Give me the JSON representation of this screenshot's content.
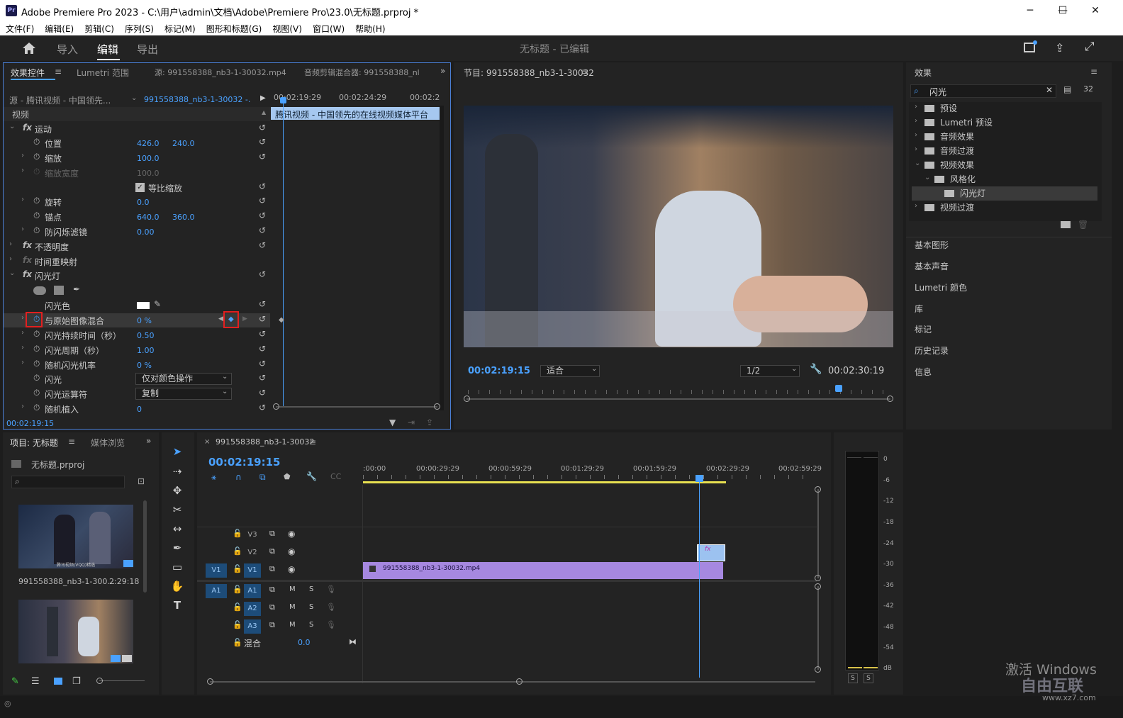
{
  "window": {
    "title": "Adobe Premiere Pro 2023 - C:\\用户\\admin\\文档\\Adobe\\Premiere Pro\\23.0\\无标题.prproj *",
    "app_icon": "Pr"
  },
  "menu": [
    "文件(F)",
    "编辑(E)",
    "剪辑(C)",
    "序列(S)",
    "标记(M)",
    "图形和标题(G)",
    "视图(V)",
    "窗口(W)",
    "帮助(H)"
  ],
  "header": {
    "tabs": [
      "导入",
      "编辑",
      "导出"
    ],
    "active_tab": "编辑",
    "doc_title": "无标题 - 已编辑"
  },
  "effect_controls": {
    "tabs": [
      "效果控件",
      "Lumetri 范围",
      "源: 991558388_nb3-1-30032.mp4",
      "音频剪辑混合器: 991558388_nl"
    ],
    "source": "源 - 腾讯视频 - 中国领先...",
    "clip": "991558388_nb3-1-30032 -...",
    "ruler": [
      "00:02:19:29",
      "00:02:24:29",
      "00:02:2"
    ],
    "clip_bar": "腾讯视频 - 中国领先的在线视频媒体平台",
    "section_video": "视频",
    "motion": "运动",
    "position": {
      "label": "位置",
      "x": "426.0",
      "y": "240.0"
    },
    "scale": {
      "label": "缩放",
      "v": "100.0"
    },
    "scale_width": {
      "label": "缩放宽度",
      "v": "100.0"
    },
    "uniform": "等比缩放",
    "rotation": {
      "label": "旋转",
      "v": "0.0"
    },
    "anchor": {
      "label": "锚点",
      "x": "640.0",
      "y": "360.0"
    },
    "antiflicker": {
      "label": "防闪烁滤镜",
      "v": "0.00"
    },
    "opacity": "不透明度",
    "time_remap": "时间重映射",
    "strobe": "闪光灯",
    "strobe_color": "闪光色",
    "blend": {
      "label": "与原始图像混合",
      "v": "0 %"
    },
    "duration": {
      "label": "闪光持续时间（秒）",
      "v": "0.50"
    },
    "period": {
      "label": "闪光周期（秒）",
      "v": "1.00"
    },
    "random": {
      "label": "随机闪光机率",
      "v": "0 %"
    },
    "flash": {
      "label": "闪光",
      "v": "仅对颜色操作"
    },
    "operator": {
      "label": "闪光运算符",
      "v": "复制"
    },
    "seed": {
      "label": "随机植入",
      "v": "0"
    },
    "timecode": "00:02:19:15"
  },
  "program": {
    "title": "节目: 991558388_nb3-1-30032",
    "timecode": "00:02:19:15",
    "fit": "适合",
    "quality": "1/2",
    "duration": "00:02:30:19",
    "playhead": 0.88
  },
  "effects": {
    "title": "效果",
    "search": "闪光",
    "tree": [
      {
        "label": "预设",
        "level": 0,
        "open": false
      },
      {
        "label": "Lumetri 预设",
        "level": 0,
        "open": false
      },
      {
        "label": "音频效果",
        "level": 0,
        "open": false
      },
      {
        "label": "音频过渡",
        "level": 0,
        "open": false
      },
      {
        "label": "视频效果",
        "level": 0,
        "open": true
      },
      {
        "label": "风格化",
        "level": 1,
        "open": true
      },
      {
        "label": "闪光灯",
        "level": 2,
        "open": false
      },
      {
        "label": "视频过渡",
        "level": 0,
        "open": false
      }
    ],
    "sections": [
      "基本图形",
      "基本声音",
      "Lumetri 颜色",
      "库",
      "标记",
      "历史记录",
      "信息"
    ]
  },
  "project": {
    "tabs": [
      "项目: 无标题",
      "媒体浏览"
    ],
    "file": "无标题.prproj",
    "clip_name": "991558388_nb3-1-300...",
    "clip_duration": "2:29:18",
    "thumb_caption": "腾讯视频(VQQ)精选"
  },
  "timeline": {
    "tab": "991558388_nb3-1-30032",
    "timecode": "00:02:19:15",
    "ruler": [
      ":00:00",
      "00:00:29:29",
      "00:00:59:29",
      "00:01:29:29",
      "00:01:59:29",
      "00:02:29:29",
      "00:02:59:29"
    ],
    "video_tracks": [
      "V3",
      "V2",
      "V1"
    ],
    "audio_tracks": [
      "A1",
      "A2",
      "A3"
    ],
    "source_v": "V1",
    "source_a": "A1",
    "mix_label": "混合",
    "mix_value": "0.0",
    "clip_name": "991558388_nb3-1-30032.mp4",
    "fx_badge": "fx",
    "m": "M",
    "s": "S"
  },
  "meter": {
    "ticks": [
      "0",
      "-6",
      "-12",
      "-18",
      "-24",
      "-30",
      "-36",
      "-42",
      "-48",
      "-54",
      "dB"
    ],
    "solo": [
      "S",
      "S"
    ]
  },
  "watermark": {
    "line1": "激活 Windows",
    "line2": "自由互联",
    "url": "www.xz7.com"
  },
  "colors": {
    "accent": "#4aa1ff",
    "highlight": "#e21f1f",
    "clip_video": "#a688e0",
    "work_area": "#e8e051"
  }
}
